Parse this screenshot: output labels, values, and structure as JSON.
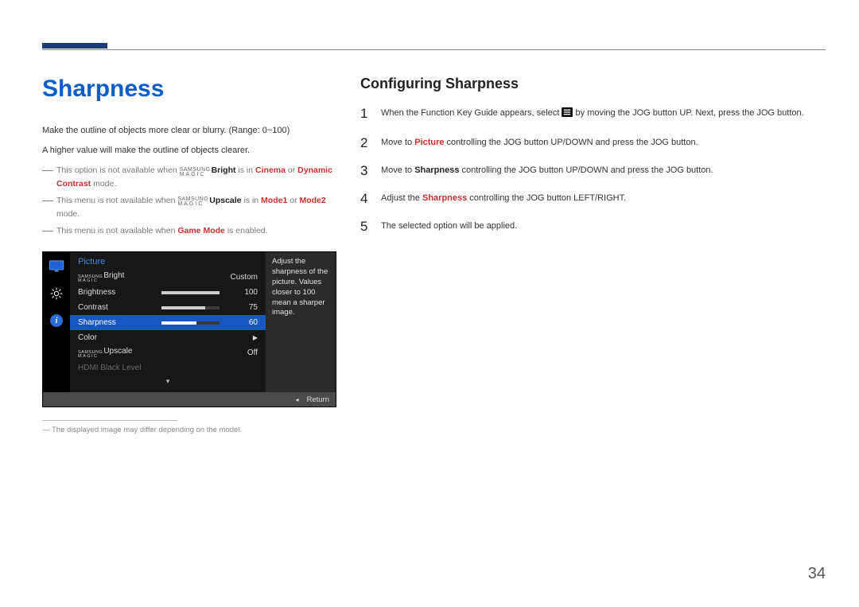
{
  "page_number": "34",
  "left": {
    "heading": "Sharpness",
    "intro1": "Make the outline of objects more clear or blurry. (Range: 0~100)",
    "intro2": "A higher value will make the outline of objects clearer.",
    "note1_pre": "This option is not available when ",
    "note1_magic": "Bright",
    "note1_mid": " is in ",
    "note1_c1": "Cinema",
    "note1_or": " or ",
    "note1_c2": "Dynamic Contrast",
    "note1_post": " mode.",
    "note2_pre": "This menu is not available when ",
    "note2_magic": "Upscale",
    "note2_mid": " is in ",
    "note2_m1": "Mode1",
    "note2_or": " or ",
    "note2_m2": "Mode2",
    "note2_post": " mode.",
    "note3_pre": "This menu is not available when ",
    "note3_gm": "Game Mode",
    "note3_post": " is enabled.",
    "footnote": "The displayed image may differ depending on the model."
  },
  "osd": {
    "title": "Picture",
    "help": "Adjust the sharpness of the picture. Values closer to 100 mean a sharper image.",
    "rows": {
      "bright_label": "Bright",
      "bright_val": "Custom",
      "brightness_label": "Brightness",
      "brightness_val": "100",
      "contrast_label": "Contrast",
      "contrast_val": "75",
      "sharpness_label": "Sharpness",
      "sharpness_val": "60",
      "color_label": "Color",
      "upscale_label": "Upscale",
      "upscale_val": "Off",
      "hdmi_label": "HDMI Black Level"
    },
    "footer_return": "Return"
  },
  "right": {
    "heading": "Configuring Sharpness",
    "steps": {
      "s1a": "When the Function Key Guide appears, select ",
      "s1b": " by moving the JOG button UP. Next, press the JOG button.",
      "s2a": "Move to ",
      "s2_pic": "Picture",
      "s2b": " controlling the JOG button UP/DOWN and press the JOG button.",
      "s3a": "Move to ",
      "s3_sh": "Sharpness",
      "s3b": " controlling the JOG button UP/DOWN and press the JOG button.",
      "s4a": "Adjust the ",
      "s4_sh": "Sharpness",
      "s4b": " controlling the JOG button LEFT/RIGHT.",
      "s5": "The selected option will be applied."
    }
  }
}
